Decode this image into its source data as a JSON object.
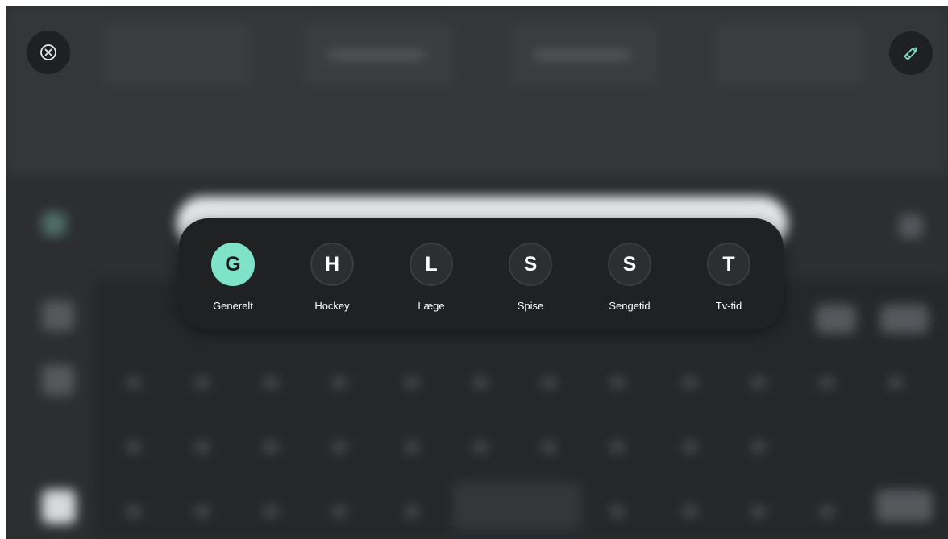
{
  "header": {
    "close_icon": "circle-x-icon",
    "edit_icon": "pencil-icon"
  },
  "profiles": [
    {
      "initial": "G",
      "name": "Generelt",
      "selected": true
    },
    {
      "initial": "H",
      "name": "Hockey",
      "selected": false
    },
    {
      "initial": "L",
      "name": "Læge",
      "selected": false
    },
    {
      "initial": "S",
      "name": "Spise",
      "selected": false
    },
    {
      "initial": "S",
      "name": "Sengetid",
      "selected": false
    },
    {
      "initial": "T",
      "name": "Tv-tid",
      "selected": false
    }
  ],
  "colors": {
    "accent": "#7fe3c9",
    "panel": "#1f2123",
    "background": "#2c2e30"
  }
}
